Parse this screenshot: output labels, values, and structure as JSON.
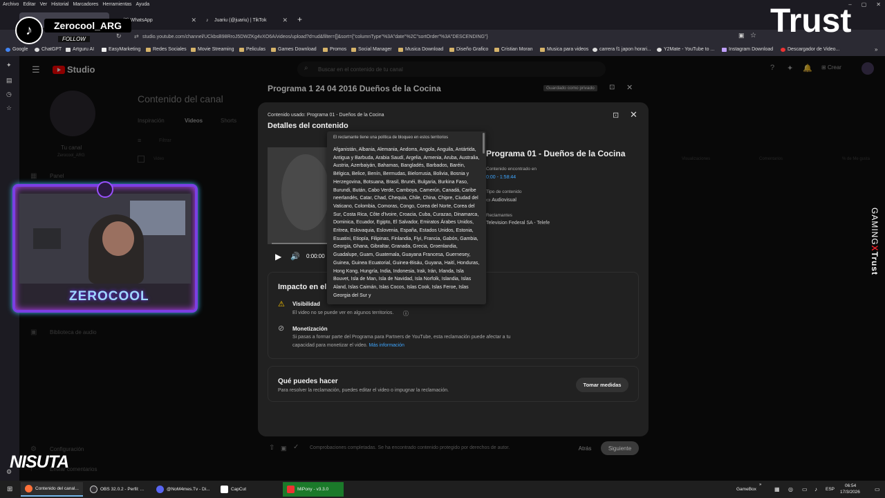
{
  "menu": [
    "Archivo",
    "Editar",
    "Ver",
    "Historial",
    "Marcadores",
    "Herramientas",
    "Ayuda"
  ],
  "tabs": [
    {
      "title": "",
      "active": true
    },
    {
      "title": "(6) WhatsApp"
    },
    {
      "title": "Juariu (@juariu) | TikTok"
    }
  ],
  "url": "studio.youtube.com/channel/UCkbsB98RroJ5DWZKg4vXO6A/videos/upload?d=ud&filter=[]&sort={\"columnType\"%3A\"date\"%2C\"sortOrder\"%3A\"DESCENDING\"}",
  "bookmarks": [
    "Google",
    "ChatGPT",
    "Artguru AI",
    "EasyMarketing",
    "Redes Sociales",
    "Movie Streaming",
    "Peliculas",
    "Games Download",
    "Promos",
    "Social Manager",
    "Musica Download",
    "Diseño Grafico",
    "Cristian Moran",
    "Musica para videos",
    "carrera f1 japon horari...",
    "Y2Mate - YouTube to ...",
    "Instagram Download",
    "Descargador de Video..."
  ],
  "studio": {
    "logo": "Studio",
    "search_placeholder": "Buscar en el contenido de tu canal",
    "create": "Crear",
    "channel_label": "Tu canal",
    "channel_handle": "Zerocool_ARG",
    "nav": [
      "Panel",
      "Biblioteca de audio",
      "Configuración",
      "Enviar comentarios"
    ],
    "page_title": "Contenido del canal",
    "page_tabs": [
      "Inspiración",
      "Videos",
      "Shorts"
    ],
    "filter_placeholder": "Filtrar",
    "columns": [
      "Video",
      "Visualizaciones",
      "Comentarios",
      "% de Me gusta"
    ]
  },
  "upload": {
    "title": "Programa 1 24 04 2016 Dueños de la Cocina",
    "saved": "Guardado como privado",
    "checks": "Comprobaciones completadas. Se ha encontrado contenido protegido por derechos de autor.",
    "back": "Atrás",
    "next": "Siguiente"
  },
  "modal": {
    "used": "Contenido usado: Programa 01 - Dueños de la Cocina",
    "title": "Detalles del contenido",
    "content_name": "Programa 01 - Dueños de la Cocina",
    "found_label": "Contenido encontrado en",
    "found_value": "0:00 - 1:58:44",
    "type_label": "Tipo de contenido",
    "type_value": "Audiovisual",
    "claimants_label": "Reclamantes",
    "claimants_value": "Television Federal SA - Telefe",
    "time": "0:00:00",
    "impact_title": "Impacto en el",
    "visibility_title": "Visibilidad",
    "visibility_text": "El video no se puede ver en algunos territorios.",
    "monetization_title": "Monetización",
    "monetization_text_1": "Si pasas a formar parte del Programa para Partners de YouTube, esta reclamación puede afectar a tu",
    "monetization_text_2": "capacidad para monetizar el video.",
    "more_info": "Más información",
    "actions_title": "Qué puedes hacer",
    "actions_text": "Para resolver la reclamación, puedes editar el video o impugnar la reclamación.",
    "actions_button": "Tomar medidas"
  },
  "popup": {
    "header": "El reclamante tiene una política de bloqueo en estos territorios",
    "territories": "Afganistán, Albania, Alemania, Andorra, Angola, Anguila, Antártida, Antigua y Barbuda, Arabia Saudí, Argelia, Armenia, Aruba, Australia, Austria, Azerbaiyán, Bahamas, Bangladés, Barbados, Baréin, Bélgica, Belice, Benín, Bermudas, Bielorrusia, Bolivia, Bosnia y Herzegovina, Botsuana, Brasil, Brunéi, Bulgaria, Burkina Faso, Burundi, Bután, Cabo Verde, Camboya, Camerún, Canadá, Caribe neerlandés, Catar, Chad, Chequia, Chile, China, Chipre, Ciudad del Vaticano, Colombia, Comoras, Congo, Corea del Norte, Corea del Sur, Costa Rica, Côte d'Ivoire, Croacia, Cuba, Curazao, Dinamarca, Dominica, Ecuador, Egipto, El Salvador, Emiratos Árabes Unidos, Eritrea, Eslovaquia, Eslovenia, España, Estados Unidos, Estonia, Esuatini, Etiopía, Filipinas, Finlandia, Fiyi, Francia, Gabón, Gambia, Georgia, Ghana, Gibraltar, Granada, Grecia, Groenlandia, Guadalupe, Guam, Guatemala, Guayana Francesa, Guernesey, Guinea, Guinea Ecuatorial, Guinea-Bisáu, Guyana, Haití, Honduras, Hong Kong, Hungría, India, Indonesia, Irak, Irán, Irlanda, Isla Bouvet, Isla de Man, Isla de Navidad, Isla Norfolk, Islandia, Islas Aland, Islas Caimán, Islas Cocos, Islas Cook, Islas Feroe, Islas Georgia del Sur y"
  },
  "overlay": {
    "tiktok_user": "Zerocool_ARG",
    "follow": "FOLLOW",
    "trust": "Trust",
    "gaming": "GAMING",
    "gaming_x": "X",
    "gaming_trust": "Trust",
    "cam_name": "ZEROCOOL",
    "nisuta": "NISUTA"
  },
  "taskbar": {
    "items": [
      "Contenido del canal...",
      "OBS 32.0.2 - Perfil: ...",
      "@NoM4mes.Tv - Di...",
      "CapCut",
      "MiPony - v3.3.0"
    ],
    "gamebox": "GameBox",
    "lang": "ESP",
    "time": "06:54",
    "date": "17/3/2026"
  }
}
